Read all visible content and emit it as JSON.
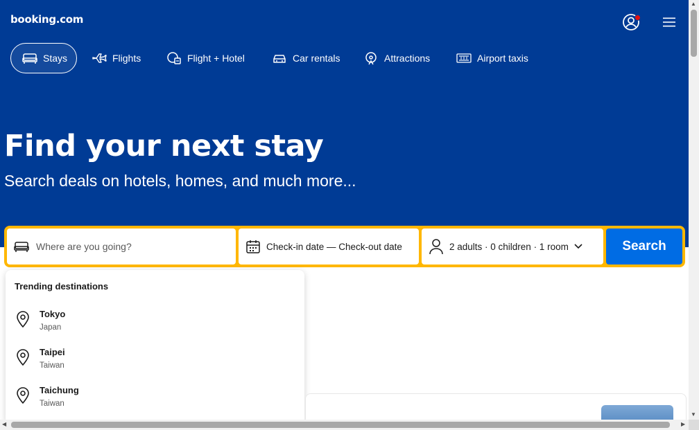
{
  "header": {
    "logo": "booking.com",
    "account_icon": "account-circle-icon",
    "menu_icon": "hamburger-menu-icon"
  },
  "nav": {
    "tabs": [
      {
        "label": "Stays",
        "icon": "bed-icon",
        "active": true
      },
      {
        "label": "Flights",
        "icon": "plane-icon",
        "active": false
      },
      {
        "label": "Flight + Hotel",
        "icon": "flight-hotel-icon",
        "active": false
      },
      {
        "label": "Car rentals",
        "icon": "car-icon",
        "active": false
      },
      {
        "label": "Attractions",
        "icon": "attractions-icon",
        "active": false
      },
      {
        "label": "Airport taxis",
        "icon": "taxi-icon",
        "active": false
      }
    ]
  },
  "hero": {
    "title": "Find your next stay",
    "subtitle": "Search deals on hotels, homes, and much more..."
  },
  "search": {
    "destination_placeholder": "Where are you going?",
    "dates_label": "Check-in date — Check-out date",
    "occupancy_label": "2 adults · 0 children · 1 room",
    "button_label": "Search"
  },
  "trending": {
    "title": "Trending destinations",
    "items": [
      {
        "name": "Tokyo",
        "country": "Japan"
      },
      {
        "name": "Taipei",
        "country": "Taiwan"
      },
      {
        "name": "Taichung",
        "country": "Taiwan"
      }
    ]
  },
  "colors": {
    "brand_blue": "#003b95",
    "accent_yellow": "#ffb700",
    "button_blue": "#006ce4",
    "notification_red": "#e21111"
  }
}
